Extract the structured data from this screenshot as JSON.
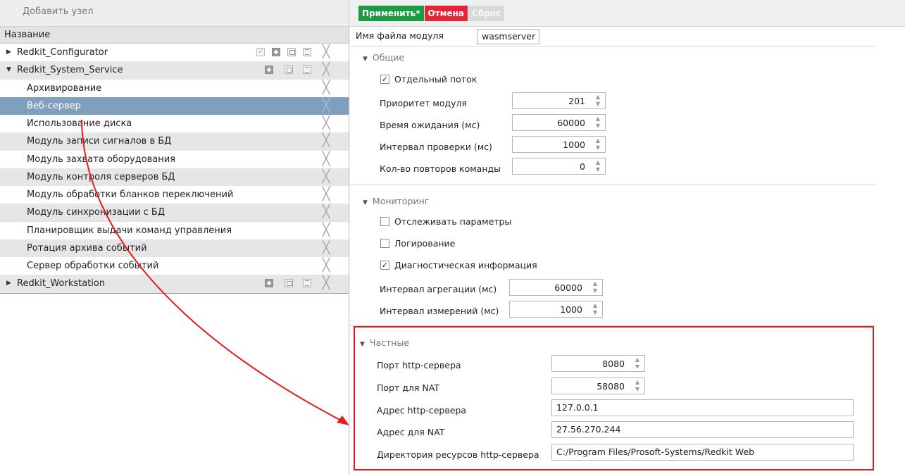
{
  "left_panel": {
    "add_node": "Добавить узел",
    "column_header": "Название",
    "tree": [
      {
        "label": "Redkit_Configurator",
        "level": 0,
        "expanded": false
      },
      {
        "label": "Redkit_System_Service",
        "level": 0,
        "expanded": true
      },
      {
        "label": "Архивирование",
        "level": 1
      },
      {
        "label": "Веб-сервер",
        "level": 1,
        "selected": true
      },
      {
        "label": "Использование диска",
        "level": 1
      },
      {
        "label": "Модуль записи сигналов в БД",
        "level": 1
      },
      {
        "label": "Модуль захвата оборудования",
        "level": 1
      },
      {
        "label": "Модуль контроля серверов БД",
        "level": 1
      },
      {
        "label": "Модуль обработки бланков переключений",
        "level": 1
      },
      {
        "label": "Модуль синхронизации с БД",
        "level": 1
      },
      {
        "label": "Планировщик выдачи команд управления",
        "level": 1
      },
      {
        "label": "Ротация архива событий",
        "level": 1
      },
      {
        "label": "Сервер обработки событий",
        "level": 1
      },
      {
        "label": "Redkit_Workstation",
        "level": 0,
        "expanded": false
      }
    ]
  },
  "toolbar": {
    "apply_label": "Применить*",
    "cancel_label": "Отмена",
    "reset_label": "Сброс"
  },
  "module": {
    "file_label": "Имя файла модуля",
    "file_value": "wasmserver"
  },
  "general": {
    "title": "Общие",
    "separate_thread": {
      "label": "Отдельный поток",
      "checked": true
    },
    "fields": [
      {
        "label": "Приоритет модуля",
        "value": "201"
      },
      {
        "label": "Время ожидания (мс)",
        "value": "60000"
      },
      {
        "label": "Интервал проверки (мс)",
        "value": "1000"
      },
      {
        "label": "Кол-во повторов команды",
        "value": "0"
      }
    ]
  },
  "monitoring": {
    "title": "Мониторинг",
    "checkboxes": [
      {
        "label": "Отслеживать параметры",
        "checked": false
      },
      {
        "label": "Логирование",
        "checked": false
      },
      {
        "label": "Диагностическая информация",
        "checked": true
      }
    ],
    "fields": [
      {
        "label": "Интервал агрегации (мс)",
        "value": "60000"
      },
      {
        "label": "Интервал измерений (мс)",
        "value": "1000"
      }
    ]
  },
  "private": {
    "title": "Частные",
    "http_port": {
      "label": "Порт http-сервера",
      "value": "8080"
    },
    "nat_port": {
      "label": "Порт для NAT",
      "value": "58080"
    },
    "http_address": {
      "label": "Адрес http-сервера",
      "value": "127.0.0.1"
    },
    "nat_address": {
      "label": "Адрес для NAT",
      "value": "27.56.270.244"
    },
    "resource_dir": {
      "label": "Директория ресурсов http-сервера",
      "value": "C:/Program Files/Prosoft-Systems/Redkit Web"
    }
  },
  "colors": {
    "apply": "#1d9a45",
    "cancel": "#e0263b",
    "selection": "#7e9fbd",
    "annotation": "#e21c1c"
  }
}
